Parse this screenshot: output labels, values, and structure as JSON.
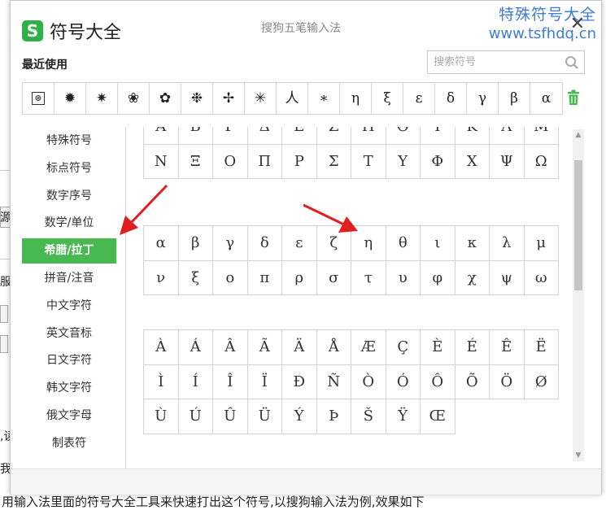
{
  "background": {
    "frag_yuan": "源",
    "frag_fu": "服",
    "frag_dou": ",读",
    "frag_wo": "我",
    "bottom_sentence": "用输入法里面的符号大全工具来快速打出这个符号,以搜狗输入法为例,效果如下"
  },
  "dialog": {
    "app_title": "符号大全",
    "ime_title": "搜狗五笔输入法",
    "logo_letter": "S",
    "close_glyph": "✕",
    "watermark_line1": "特殊符号大全",
    "watermark_line2": "www.tsfhdq.cn"
  },
  "recent": {
    "label": "最近使用",
    "search_placeholder": "搜索符号",
    "symbols": [
      "⊛",
      "✹",
      "✷",
      "❀",
      "✿",
      "❉",
      "✢",
      "✳",
      "⼈",
      "∗",
      "η",
      "ξ",
      "ε",
      "δ",
      "γ",
      "β",
      "α"
    ]
  },
  "sidebar": {
    "items": [
      "特殊符号",
      "标点符号",
      "数字序号",
      "数学/单位",
      "希腊/拉丁",
      "拼音/注音",
      "中文字符",
      "英文音标",
      "日文字符",
      "韩文字符",
      "俄文字母",
      "制表符"
    ],
    "active_index": 4
  },
  "grids": {
    "greek_upper": [
      "Α",
      "Β",
      "Γ",
      "Δ",
      "Ε",
      "Ζ",
      "Η",
      "Θ",
      "Ι",
      "Κ",
      "Λ",
      "Μ",
      "Ν",
      "Ξ",
      "Ο",
      "Π",
      "Ρ",
      "Σ",
      "Τ",
      "Υ",
      "Φ",
      "Χ",
      "Ψ",
      "Ω"
    ],
    "greek_lower": [
      "α",
      "β",
      "γ",
      "δ",
      "ε",
      "ζ",
      "η",
      "θ",
      "ι",
      "κ",
      "λ",
      "μ",
      "ν",
      "ξ",
      "ο",
      "π",
      "ρ",
      "σ",
      "τ",
      "υ",
      "φ",
      "χ",
      "ψ",
      "ω"
    ],
    "latin_ext": [
      "À",
      "Á",
      "Â",
      "Ã",
      "Ä",
      "Å",
      "Æ",
      "Ç",
      "È",
      "É",
      "Ê",
      "Ë",
      "Ì",
      "Í",
      "Î",
      "Ï",
      "Ð",
      "Ñ",
      "Ò",
      "Ó",
      "Ô",
      "Õ",
      "Ö",
      "Ø",
      "Ù",
      "Ú",
      "Û",
      "Ü",
      "Ý",
      "Þ",
      "Š",
      "Ÿ",
      "Œ"
    ]
  },
  "colors": {
    "accent_green": "#47b950",
    "watermark_blue": "#3d7dd6",
    "annotation_red": "#e02020"
  }
}
